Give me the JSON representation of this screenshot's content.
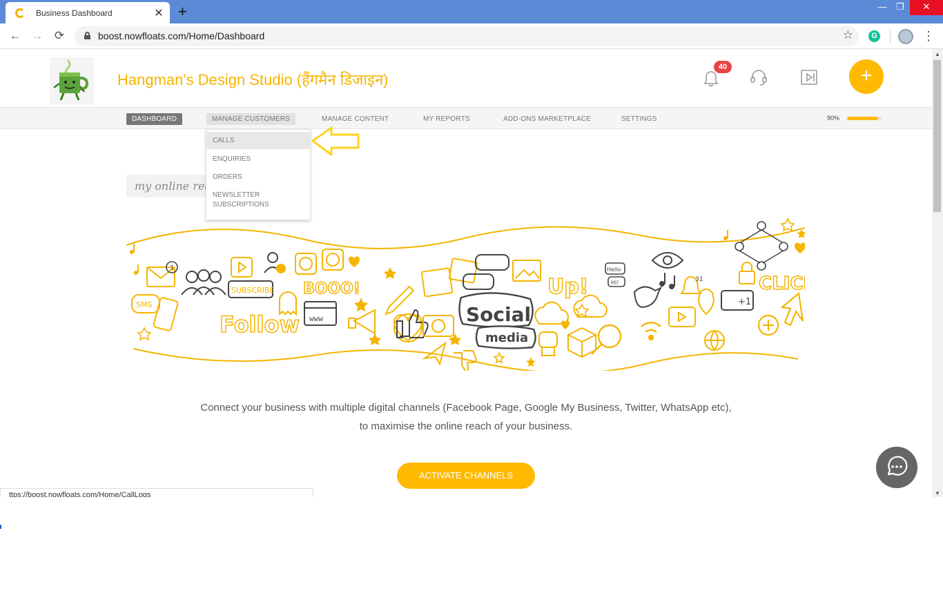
{
  "browser": {
    "tab_title": "Business Dashboard",
    "tab_close": "✕",
    "new_tab": "+",
    "url": "boost.nowfloats.com/Home/Dashboard",
    "window_controls": {
      "minimize": "—",
      "maximize": "❐",
      "close": "✕"
    },
    "extension_letter": "G"
  },
  "header": {
    "business_name": "Hangman's Design Studio (हैंगमैन डिजाइन)",
    "notification_count": "40",
    "add_button": "+"
  },
  "nav": {
    "items": [
      {
        "label": "DASHBOARD"
      },
      {
        "label": "MANAGE CUSTOMERS"
      },
      {
        "label": "MANAGE CONTENT"
      },
      {
        "label": "MY REPORTS"
      },
      {
        "label": "ADD-ONS MARKETPLACE"
      },
      {
        "label": "SETTINGS"
      }
    ],
    "active": "DASHBOARD",
    "profile_completion": {
      "label": "90%",
      "value": 0.9
    }
  },
  "dropdown": {
    "items": [
      {
        "label": "CALLS"
      },
      {
        "label": "ENQUIRIES"
      },
      {
        "label": "ORDERS"
      },
      {
        "label": "NEWSLETTER SUBSCRIPTIONS"
      }
    ]
  },
  "main": {
    "section_heading": "my online reach",
    "illustration": {
      "texts": [
        "SUBSCRIBE",
        "BOOO!",
        "Follow",
        "Social",
        "media",
        "Up!",
        "CLICK",
        "SMS",
        "www",
        "Hello",
        "Hi!",
        "+1",
        "31",
        "1"
      ],
      "icon_names": [
        "email-icon",
        "group-icon",
        "add-user-icon",
        "smiley-icon",
        "heart-icon",
        "thumbs-up-icon",
        "camera-icon",
        "megaphone-icon",
        "cloud-icon",
        "search-icon",
        "eye-icon",
        "bell-icon",
        "play-icon",
        "music-note-icon",
        "bird-icon",
        "star-icon",
        "phone-icon",
        "wifi-icon",
        "globe-icon",
        "robot-icon",
        "pen-icon",
        "ghost-icon",
        "network-icon",
        "cursor-icon"
      ]
    },
    "description_line1": "Connect your business with multiple digital channels (Facebook Page, Google My Business, Twitter, WhatsApp etc),",
    "description_line2": "to maximise the online reach of your business.",
    "cta_label": "ACTIVATE CHANNELS"
  },
  "status_bar_url": "ttps://boost.nowfloats.com/Home/CallLogs",
  "colors": {
    "brand": "#f5b400",
    "accent_button": "#ffb900",
    "badge": "#e84545",
    "chrome_titlebar": "#5b8ad6",
    "illustration_line": "#444444"
  }
}
